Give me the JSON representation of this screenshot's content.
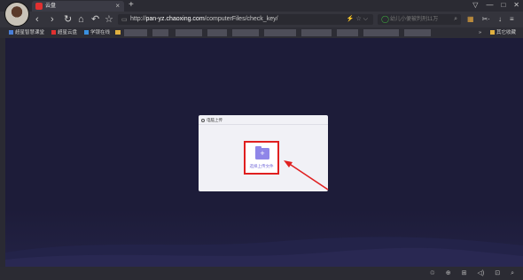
{
  "tab": {
    "title": "云盘",
    "close": "×",
    "new_tab": "+"
  },
  "window_controls": [
    "▽",
    "—",
    "□",
    "✕"
  ],
  "nav": {
    "back": "‹",
    "forward": "›",
    "reload": "↻",
    "home": "⌂",
    "undo": "↶",
    "favorite": "☆",
    "url_prefix": "http://",
    "url_host": "pan-yz.chaoxing.com",
    "url_path": "/computerFiles/check_key/",
    "url_icons": "⚡ ☆ ⌵",
    "search_placeholder": "幼儿小便被判刑11万",
    "search_icon": "⌕",
    "right_tools": [
      "▦",
      "✂·",
      "↓",
      "≡"
    ]
  },
  "bookmarks": {
    "items": [
      {
        "label": "超星智慧课堂",
        "color": "#4a7fd8"
      },
      {
        "label": "超星云盘",
        "color": "#e03030"
      },
      {
        "label": "学银在线",
        "color": "#3a90e0"
      }
    ],
    "more": "»",
    "other": "其它收藏"
  },
  "panel": {
    "title": "电脑上传",
    "upload_label": "选择上传文件",
    "upload_icon": "+"
  },
  "status_icons": [
    "♲",
    "⊕",
    "⊞",
    "◁)",
    "⊡",
    "⌕"
  ]
}
